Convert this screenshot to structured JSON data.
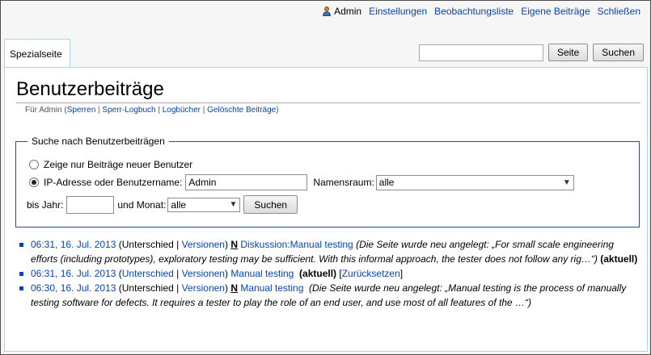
{
  "personal": {
    "user": "Admin",
    "links": [
      "Einstellungen",
      "Beobachtungsliste",
      "Eigene Beiträge",
      "Schließen"
    ]
  },
  "tab": {
    "label": "Spezialseite"
  },
  "search": {
    "value": "",
    "go_label": "Seite",
    "search_label": "Suchen"
  },
  "page": {
    "title": "Benutzerbeiträge",
    "sub_prefix": "Für Admin (",
    "sub_links": [
      "Sperren",
      "Sperr-Logbuch",
      "Logbücher",
      "Gelöschte Beiträge"
    ],
    "sub_suffix": ")"
  },
  "form": {
    "legend": "Suche nach Benutzerbeiträgen",
    "radio_newbies": "Zeige nur Beiträge neuer Benutzer",
    "radio_ip": "IP-Adresse oder Benutzername:",
    "username_value": "Admin",
    "namespace_label": "Namensraum:",
    "namespace_value": "alle",
    "year_label": "bis Jahr:",
    "year_value": "",
    "month_label": "und Monat:",
    "month_value": "alle",
    "submit_label": "Suchen"
  },
  "contribs": [
    {
      "timestamp": "06:31, 16. Jul. 2013",
      "diff": "Unterschied",
      "hist": "Versionen",
      "flag": "N",
      "page": "Diskussion:Manual testing",
      "summary": "(Die Seite wurde neu angelegt: „For small scale engineering efforts (including prototypes), exploratory testing may be sufficient. With this informal approach, the tester does not follow any rig…“)",
      "current": "(aktuell)"
    },
    {
      "timestamp": "06:31, 16. Jul. 2013",
      "diff": "Unterschied",
      "hist": "Versionen",
      "page": "Manual testing",
      "current": "(aktuell)",
      "rollback": "Zurücksetzen"
    },
    {
      "timestamp": "06:30, 16. Jul. 2013",
      "diff": "Unterschied",
      "hist": "Versionen",
      "flag": "N",
      "page": "Manual testing",
      "summary": "(Die Seite wurde neu angelegt: „Manual testing is the process of manually testing software for defects. It requires a tester to play the role of an end user, and use most of all features of the …“)"
    }
  ],
  "colors": {
    "link": "#0645ad",
    "border": "#a7d7f9",
    "fieldset": "#2a4b8d"
  }
}
